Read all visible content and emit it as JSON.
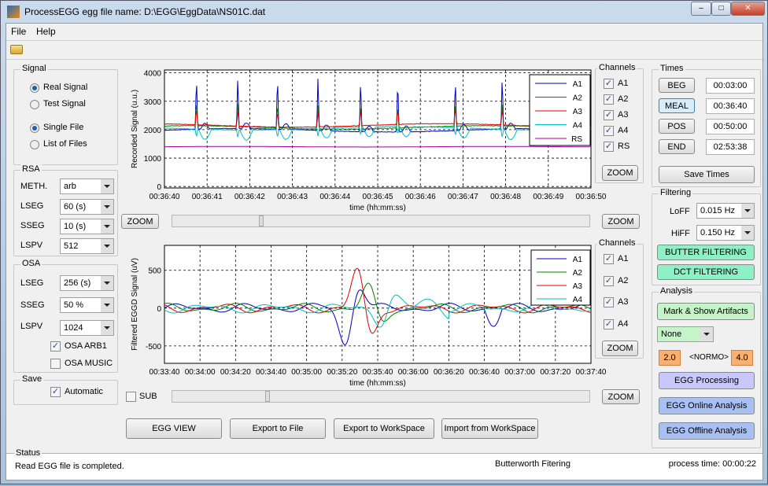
{
  "window": {
    "app": "ProcessEGG",
    "title": "ProcessEGG   egg file name: D:\\EGG\\EggData\\NS01C.dat"
  },
  "menu": [
    "File",
    "Help"
  ],
  "toolbar": {
    "open_icon": "folder-open-icon"
  },
  "signal": {
    "title": "Signal",
    "options1": [
      {
        "label": "Real Signal",
        "selected": true
      },
      {
        "label": "Test Signal",
        "selected": false
      }
    ],
    "options2": [
      {
        "label": "Single File",
        "selected": true
      },
      {
        "label": "List of Files",
        "selected": false
      }
    ]
  },
  "rsa": {
    "title": "RSA",
    "fields": [
      {
        "label": "METH.",
        "value": "arb"
      },
      {
        "label": "LSEG",
        "value": "60 (s)"
      },
      {
        "label": "SSEG",
        "value": "10 (s)"
      },
      {
        "label": "LSPV",
        "value": "512"
      }
    ]
  },
  "osa": {
    "title": "OSA",
    "fields": [
      {
        "label": "LSEG",
        "value": "256 (s)"
      },
      {
        "label": "SSEG",
        "value": "50 %"
      },
      {
        "label": "LSPV",
        "value": "1024"
      }
    ],
    "checks": [
      {
        "label": "OSA ARB1",
        "checked": true
      },
      {
        "label": "OSA MUSIC",
        "checked": false
      }
    ]
  },
  "save": {
    "title": "Save",
    "check": {
      "label": "Automatic",
      "checked": true
    }
  },
  "top_plot": {
    "ylabel": "Recorded Signal (u.u.)",
    "xlabel": "time (hh:mm:ss)",
    "yticks": [
      0,
      1000,
      2000,
      3000,
      4000
    ],
    "ylim": [
      -50,
      4100
    ],
    "xticks": [
      "00:36:40",
      "00:36:41",
      "00:36:42",
      "00:36:43",
      "00:36:44",
      "00:36:45",
      "00:36:46",
      "00:36:47",
      "00:36:48",
      "00:36:49",
      "00:36:50"
    ],
    "series": [
      {
        "name": "A1",
        "color": "#0000c0",
        "baseline": 1980
      },
      {
        "name": "A2",
        "color": "#008000",
        "baseline": 2080
      },
      {
        "name": "A3",
        "color": "#e00000",
        "baseline": 2150
      },
      {
        "name": "A4",
        "color": "#00c0c0",
        "baseline": 2050
      },
      {
        "name": "RS",
        "color": "#a000a0",
        "baseline": 1400
      }
    ],
    "spike_times_s": [
      0.75,
      1.72,
      2.65,
      3.6,
      4.6,
      5.47,
      6.82,
      7.92
    ]
  },
  "top_channels": {
    "title": "Channels",
    "items": [
      {
        "label": "A1",
        "checked": true
      },
      {
        "label": "A2",
        "checked": true
      },
      {
        "label": "A3",
        "checked": true
      },
      {
        "label": "A4",
        "checked": true
      },
      {
        "label": "RS",
        "checked": true
      }
    ],
    "zoom": "ZOOM"
  },
  "top_zoom_left": "ZOOM",
  "top_zoom_right": "ZOOM",
  "bottom_plot": {
    "ylabel": "Filtered EGGD Signal (uV)",
    "xlabel": "time (hh:mm:ss)",
    "yticks": [
      -500,
      0,
      500
    ],
    "ylim": [
      -730,
      830
    ],
    "xticks": [
      "00:33:40",
      "00:34:00",
      "00:34:20",
      "00:34:40",
      "00:35:00",
      "00:35:20",
      "00:35:40",
      "00:36:00",
      "00:36:20",
      "00:36:40",
      "00:37:00",
      "00:37:20",
      "00:37:40"
    ],
    "series": [
      {
        "name": "A1",
        "color": "#0000c0"
      },
      {
        "name": "A2",
        "color": "#008000"
      },
      {
        "name": "A3",
        "color": "#e00000"
      },
      {
        "name": "A4",
        "color": "#00c0c0"
      }
    ]
  },
  "bottom_channels": {
    "title": "Channels",
    "items": [
      {
        "label": "A1",
        "checked": true
      },
      {
        "label": "A2",
        "checked": true
      },
      {
        "label": "A3",
        "checked": true
      },
      {
        "label": "A4",
        "checked": true
      }
    ],
    "zoom": "ZOOM"
  },
  "sub": {
    "label": "SUB",
    "checked": false
  },
  "bottom_zoom_right": "ZOOM",
  "actions": [
    "EGG VIEW",
    "Export to File",
    "Export to WorkSpace",
    "Import from WorkSpace"
  ],
  "times": {
    "title": "Times",
    "rows": [
      {
        "label": "BEG",
        "value": "00:03:00"
      },
      {
        "label": "MEAL",
        "value": "00:36:40"
      },
      {
        "label": "POS",
        "value": "00:50:00"
      },
      {
        "label": "END",
        "value": "02:53:38"
      }
    ],
    "save": "Save Times"
  },
  "filtering": {
    "title": "Filtering",
    "loff": {
      "label": "LoFF",
      "value": "0.015 Hz"
    },
    "hiff": {
      "label": "HiFF",
      "value": "0.150 Hz"
    },
    "butter": "BUTTER FILTERING",
    "dct": "DCT FILTERING",
    "color": "#8ef0c4"
  },
  "analysis": {
    "title": "Analysis",
    "artifacts": "Mark & Show Artifacts",
    "mode": "None",
    "low": "2.0",
    "normo": "<NORMO>",
    "high": "4.0",
    "processing": "EGG Processing",
    "online": "EGG Online Analysis",
    "offline": "EGG Offline Analysis"
  },
  "status": {
    "title": "Status",
    "message": "Read EGG file is completed.",
    "filter": "Butterworth Fitering",
    "process_time": "process time: 00:00:22"
  }
}
